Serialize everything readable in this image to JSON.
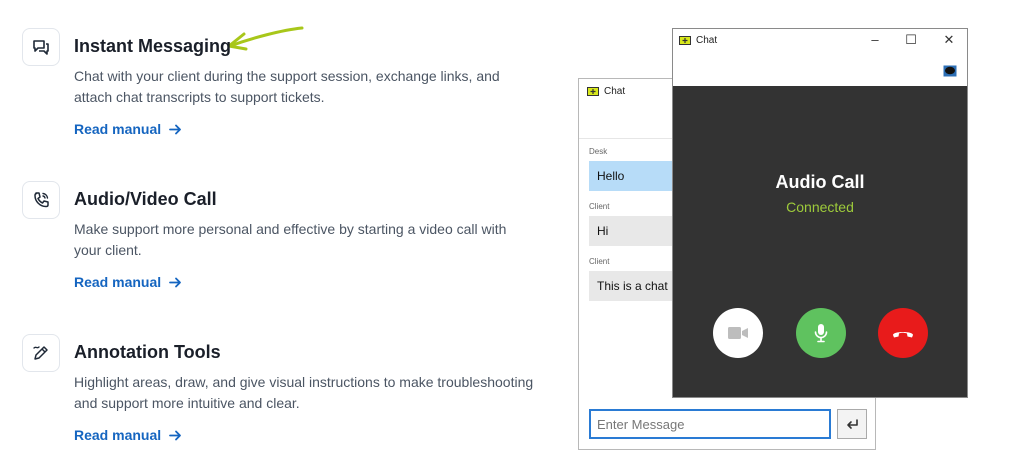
{
  "features": [
    {
      "title": "Instant Messaging",
      "desc": "Chat with your client during the support session, exchange links, and attach chat transcripts to support tickets.",
      "link": "Read manual",
      "icon": "chat-bubbles-icon"
    },
    {
      "title": "Audio/Video Call",
      "desc": "Make support more personal and effective by starting a video call with your client.",
      "link": "Read manual",
      "icon": "phone-call-icon"
    },
    {
      "title": "Annotation Tools",
      "desc": "Highlight areas, draw, and give visual instructions to make troubleshooting and support more intuitive and clear.",
      "link": "Read manual",
      "icon": "pen-draw-icon"
    }
  ],
  "chat_window": {
    "title": "Chat",
    "messages": [
      {
        "sender": "Desk",
        "text": "Hello"
      },
      {
        "sender": "Client",
        "text": "Hi"
      },
      {
        "sender": "Client",
        "text": "This is a chat"
      }
    ],
    "input_placeholder": "Enter Message"
  },
  "call_window": {
    "title": "Chat",
    "minimize": "–",
    "maximize": "☐",
    "close": "✕",
    "heading": "Audio Call",
    "status": "Connected"
  },
  "colors": {
    "accent_link": "#1565c0",
    "arrow_accent": "#a8c71a",
    "status_green": "#9ecb3b",
    "mic_green": "#5fc25f",
    "hangup_red": "#e81b1b",
    "call_bg": "#333333"
  }
}
